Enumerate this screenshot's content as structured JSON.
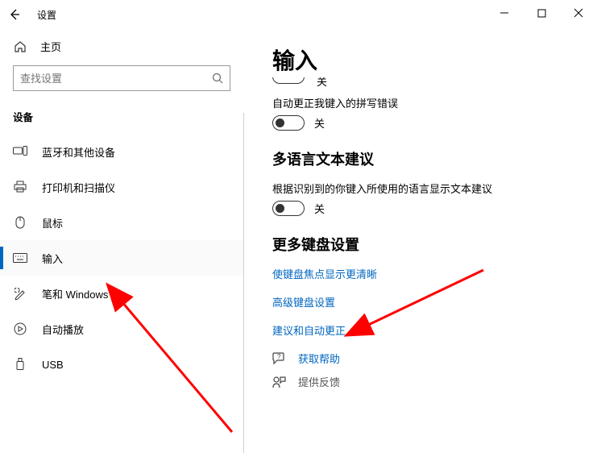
{
  "titlebar": {
    "title": "设置"
  },
  "sidebar": {
    "home_label": "主页",
    "search_placeholder": "查找设置",
    "section_label": "设备",
    "items": [
      {
        "label": "蓝牙和其他设备"
      },
      {
        "label": "打印机和扫描仪"
      },
      {
        "label": "鼠标"
      },
      {
        "label": "输入"
      },
      {
        "label": "笔和 Windows Ink"
      },
      {
        "label": "自动播放"
      },
      {
        "label": "USB"
      }
    ]
  },
  "content": {
    "page_title": "输入",
    "cutoff_toggle_state": "关",
    "autocorrect": {
      "desc": "自动更正我键入的拼写错误",
      "state": "关"
    },
    "multilang": {
      "heading": "多语言文本建议",
      "desc": "根据识别到的你键入所使用的语言显示文本建议",
      "state": "关"
    },
    "more_kb": {
      "heading": "更多键盘设置",
      "links": [
        "使键盘焦点显示更清晰",
        "高级键盘设置",
        "建议和自动更正"
      ]
    },
    "help": {
      "get_help": "获取帮助",
      "feedback": "提供反馈"
    }
  }
}
